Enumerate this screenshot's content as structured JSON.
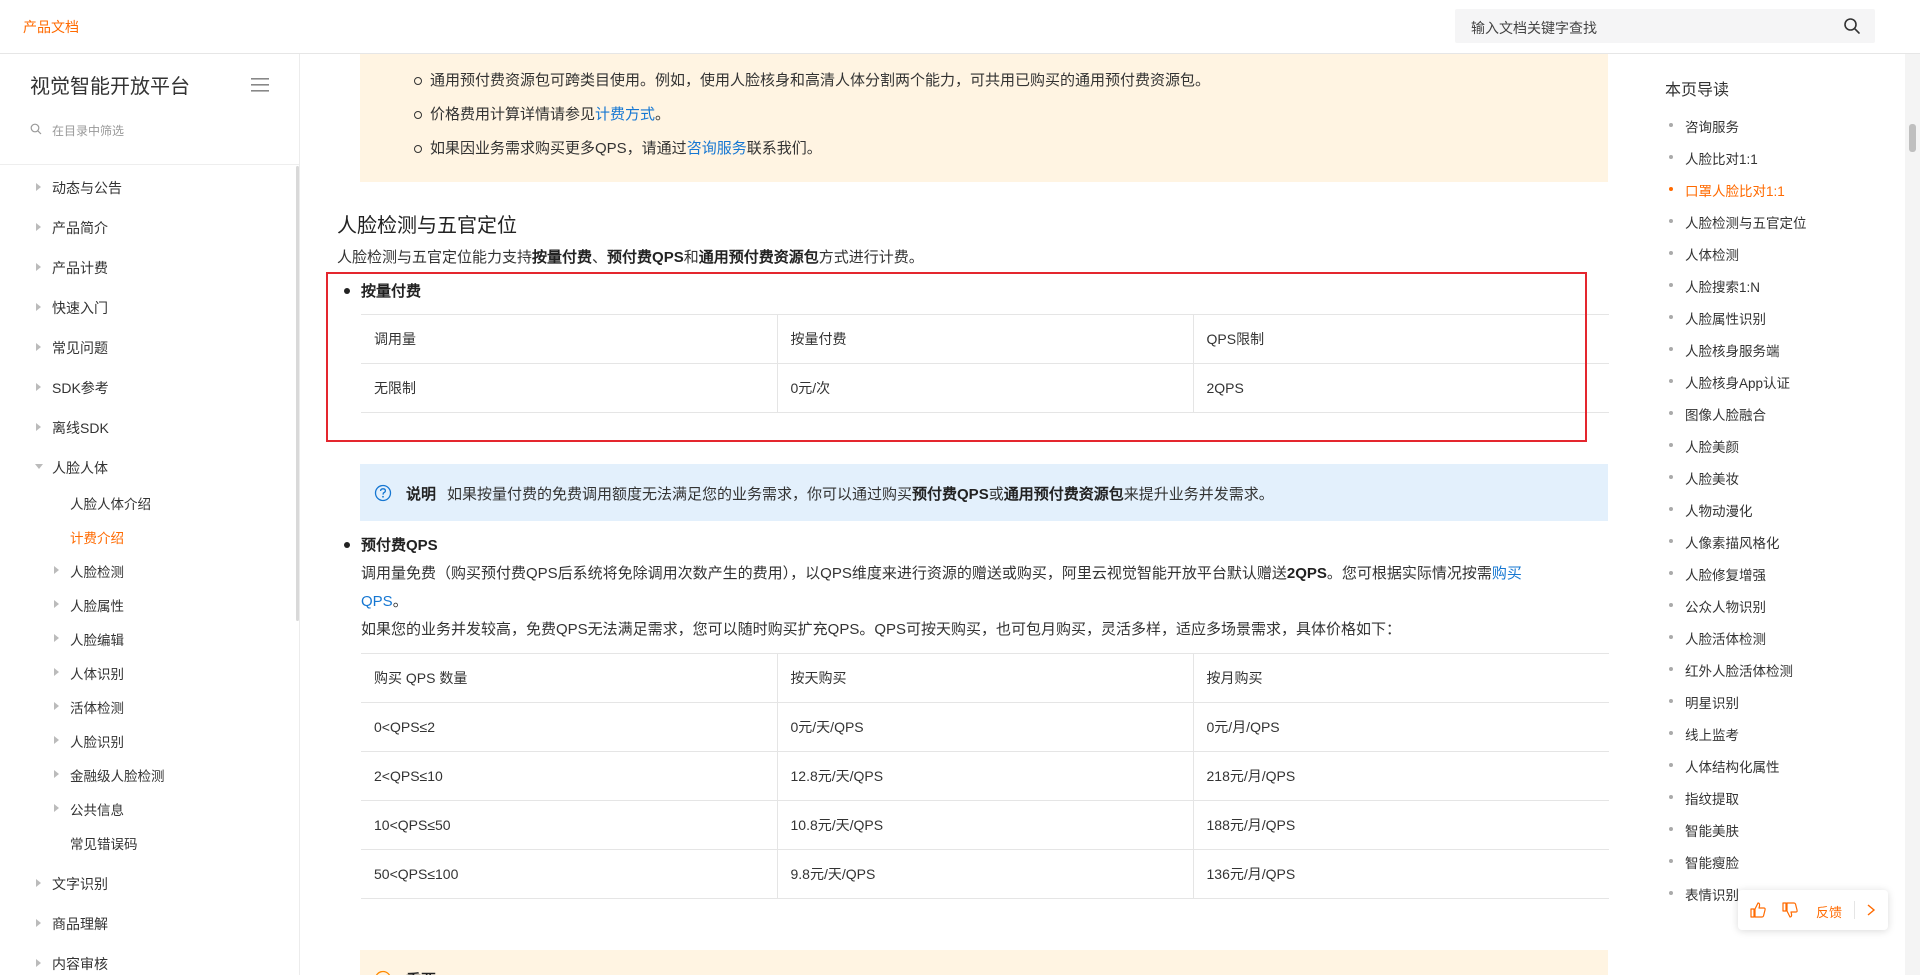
{
  "header": {
    "brand": "产品文档",
    "search_placeholder": "输入文档关键字查找"
  },
  "sidebar": {
    "title": "视觉智能开放平台",
    "filter_placeholder": "在目录中筛选",
    "items": [
      {
        "label": "动态与公告"
      },
      {
        "label": "产品简介"
      },
      {
        "label": "产品计费"
      },
      {
        "label": "快速入门"
      },
      {
        "label": "常见问题"
      },
      {
        "label": "SDK参考"
      },
      {
        "label": "离线SDK"
      },
      {
        "label": "人脸人体"
      },
      {
        "label": "人脸人体介绍"
      },
      {
        "label": "计费介绍"
      },
      {
        "label": "人脸检测"
      },
      {
        "label": "人脸属性"
      },
      {
        "label": "人脸编辑"
      },
      {
        "label": "人体识别"
      },
      {
        "label": "活体检测"
      },
      {
        "label": "人脸识别"
      },
      {
        "label": "金融级人脸检测"
      },
      {
        "label": "公共信息"
      },
      {
        "label": "常见错误码"
      },
      {
        "label": "文字识别"
      },
      {
        "label": "商品理解"
      },
      {
        "label": "内容审核"
      }
    ]
  },
  "main": {
    "top_notes": {
      "n1": "通用预付费资源包可跨类目使用。例如，使用人脸核身和高清人体分割两个能力，可共用已购买的通用预付费资源包。",
      "n2_pre": "价格费用计算详情请参见",
      "n2_link": "计费方式",
      "n2_post": "。",
      "n3_pre": "如果因业务需求购买更多QPS，请通过",
      "n3_link": "咨询服务",
      "n3_post": "联系我们。"
    },
    "section_title": "人脸检测与五官定位",
    "intro": {
      "pre": "人脸检测与五官定位能力支持",
      "b1": "按量付费",
      "sep1": "、",
      "b2": "预付费QPS",
      "sep2": "和",
      "b3": "通用预付费资源包",
      "post": "方式进行计费。"
    },
    "payg": {
      "title": "按量付费",
      "headers": [
        "调用量",
        "按量付费",
        "QPS限制"
      ],
      "rows": [
        [
          "无限制",
          "0元/次",
          "2QPS"
        ]
      ]
    },
    "note": {
      "label": "说明",
      "pre": "如果按量付费的免费调用额度无法满足您的业务需求，你可以通过购买",
      "b1": "预付费QPS",
      "mid": "或",
      "b2": "通用预付费资源包",
      "post": "来提升业务并发需求。"
    },
    "prepaid": {
      "title": "预付费QPS",
      "line1_pre": "调用量免费（购买预付费QPS后系统将免除调用次数产生的费用），以QPS维度来进行资源的赠送或购买，阿里云视觉智能开放平台默认赠送",
      "line1_bold": "2QPS",
      "line1_post": "。您可根据实际情况按需",
      "line1_link": "购买",
      "line2_link": "QPS",
      "line2_post": "。",
      "line3": "如果您的业务并发较高，免费QPS无法满足需求，您可以随时购买扩充QPS。QPS可按天购买，也可包月购买，灵活多样，适应多场景需求，具体价格如下：",
      "headers": [
        "购买 QPS 数量",
        "按天购买",
        "按月购买"
      ],
      "rows": [
        [
          "0<QPS≤2",
          "0元/天/QPS",
          "0元/月/QPS"
        ],
        [
          "2<QPS≤10",
          "12.8元/天/QPS",
          "218元/月/QPS"
        ],
        [
          "10<QPS≤50",
          "10.8元/天/QPS",
          "188元/月/QPS"
        ],
        [
          "50<QPS≤100",
          "9.8元/天/QPS",
          "136元/月/QPS"
        ]
      ]
    },
    "important_label": "重要"
  },
  "toc": {
    "title": "本页导读",
    "items": [
      {
        "label": "咨询服务"
      },
      {
        "label": "人脸比对1:1"
      },
      {
        "label": "口罩人脸比对1:1"
      },
      {
        "label": "人脸检测与五官定位"
      },
      {
        "label": "人体检测"
      },
      {
        "label": "人脸搜索1:N"
      },
      {
        "label": "人脸属性识别"
      },
      {
        "label": "人脸核身服务端"
      },
      {
        "label": "人脸核身App认证"
      },
      {
        "label": "图像人脸融合"
      },
      {
        "label": "人脸美颜"
      },
      {
        "label": "人脸美妆"
      },
      {
        "label": "人物动漫化"
      },
      {
        "label": "人像素描风格化"
      },
      {
        "label": "人脸修复增强"
      },
      {
        "label": "公众人物识别"
      },
      {
        "label": "人脸活体检测"
      },
      {
        "label": "红外人脸活体检测"
      },
      {
        "label": "明星识别"
      },
      {
        "label": "线上监考"
      },
      {
        "label": "人体结构化属性"
      },
      {
        "label": "指纹提取"
      },
      {
        "label": "智能美肤"
      },
      {
        "label": "智能瘦脸"
      },
      {
        "label": "表情识别"
      }
    ]
  },
  "feedback": {
    "label": "反馈"
  },
  "colors": {
    "accent": "#ff6a00",
    "link": "#1677d2",
    "warn_bg": "#fff4e2",
    "note_bg": "#e3f0fc",
    "highlight": "#e4262e"
  }
}
